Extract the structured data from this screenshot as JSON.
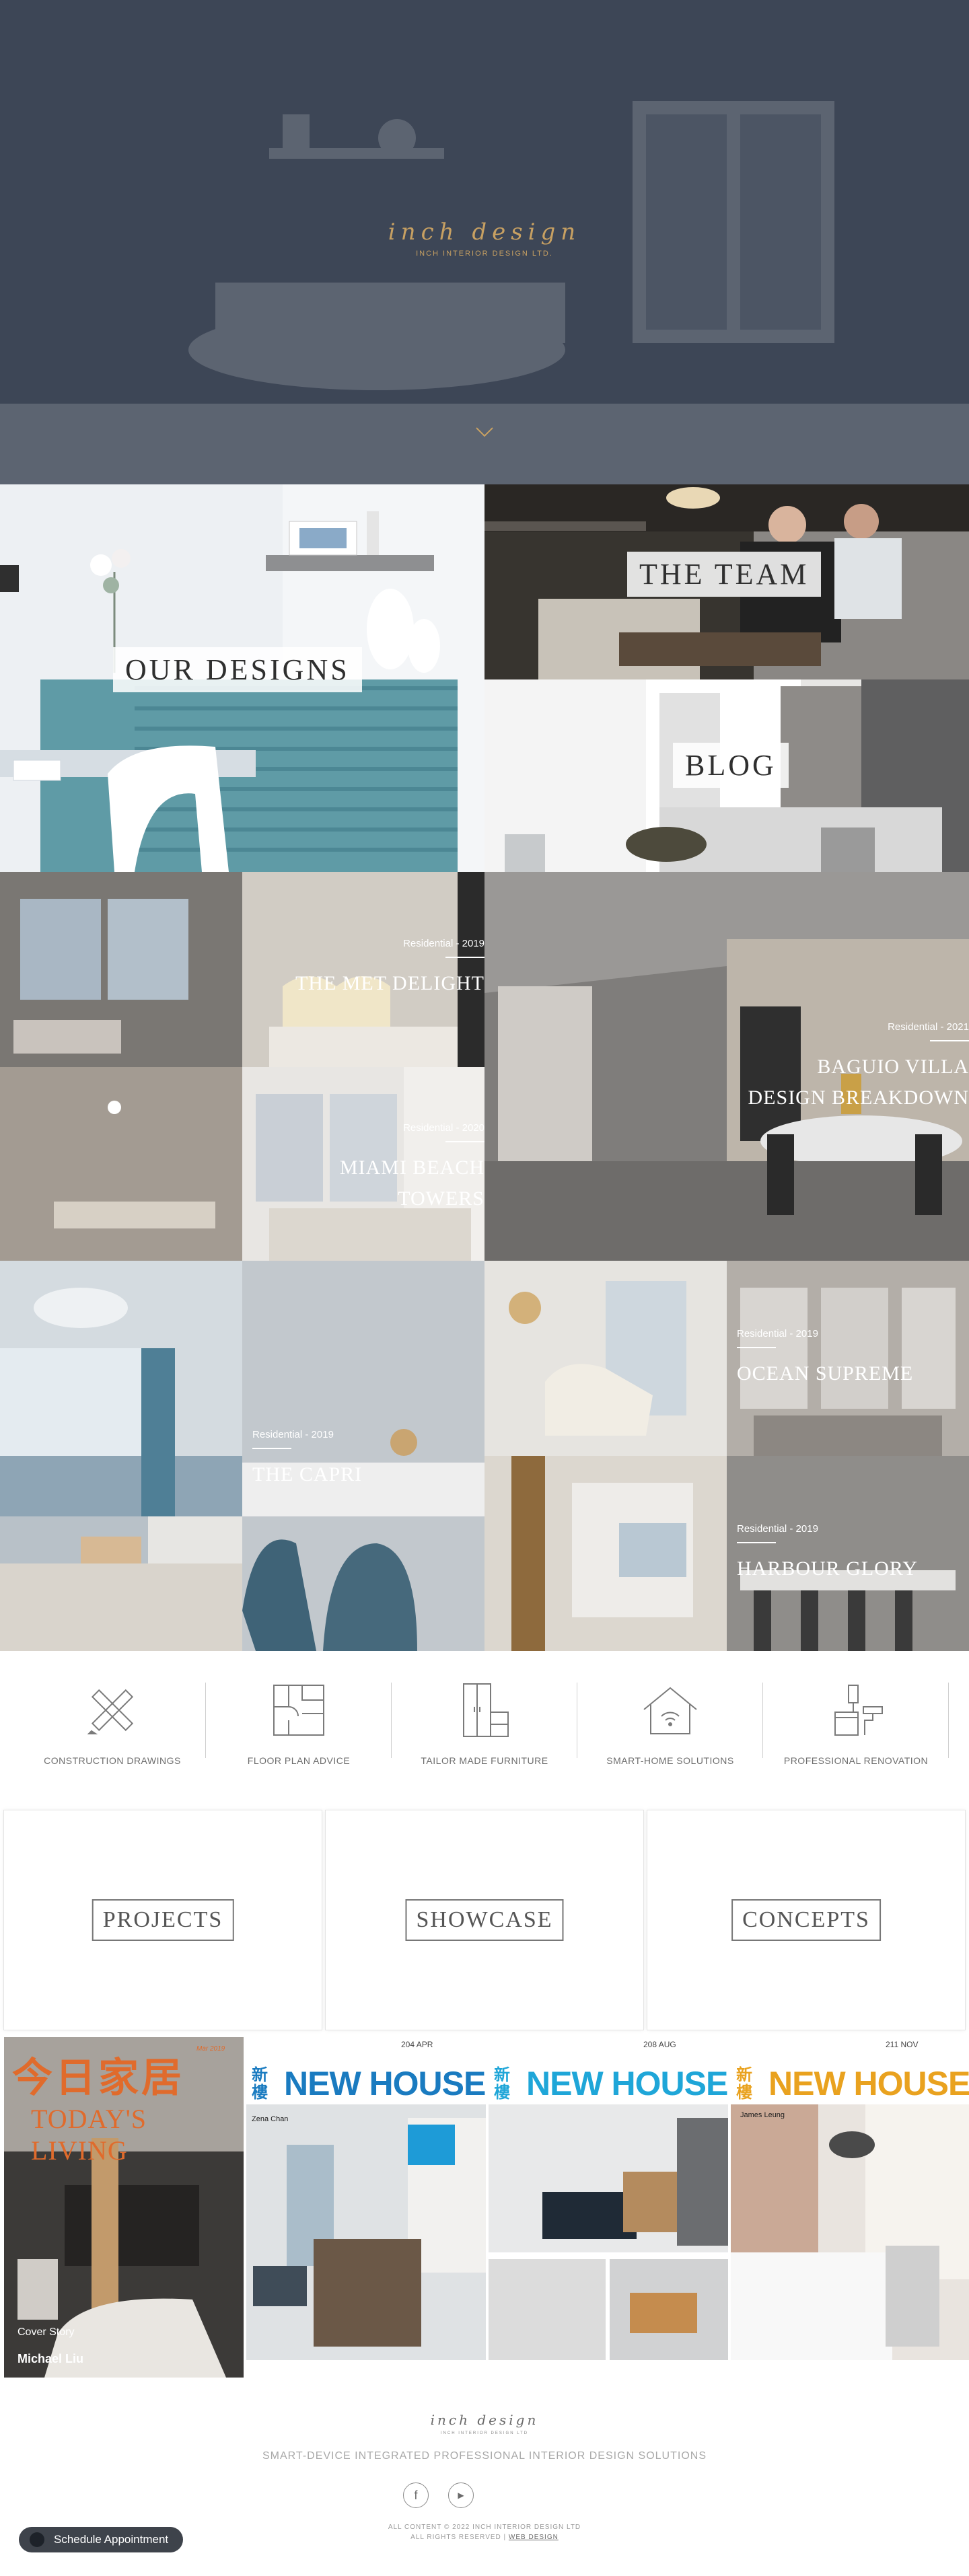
{
  "hero": {
    "logo_script": "inch design",
    "logo_sub": "INCH INTERIOR DESIGN LTD."
  },
  "tiles": {
    "our_designs": "OUR DESIGNS",
    "the_team": "THE TEAM",
    "blog": "BLOG"
  },
  "projects": [
    {
      "meta": "Residential - 2019",
      "title": "THE MET DELIGHT"
    },
    {
      "meta": "Residential - 2021",
      "title": "BAGUIO VILLA",
      "title2": "DESIGN BREAKDOWN"
    },
    {
      "meta": "Residential - 2020",
      "title": "MIAMI BEACH",
      "title2": "TOWERS"
    },
    {
      "meta": "Residential - 2019",
      "title": "THE CAPRI"
    },
    {
      "meta": "Residential - 2019",
      "title": "OCEAN SUPREME"
    },
    {
      "meta": "Residential - 2019",
      "title": "HARBOUR GLORY"
    }
  ],
  "services": [
    {
      "label": "CONSTRUCTION DRAWINGS",
      "icon": "ruler-pencil-icon"
    },
    {
      "label": "FLOOR PLAN ADVICE",
      "icon": "floor-plan-icon"
    },
    {
      "label": "TAILOR MADE FURNITURE",
      "icon": "wardrobe-icon"
    },
    {
      "label": "SMART-HOME SOLUTIONS",
      "icon": "smart-home-icon"
    },
    {
      "label": "PROFESSIONAL RENOVATION",
      "icon": "paint-roller-icon"
    }
  ],
  "categories": {
    "projects": "PROJECTS",
    "showcase": "SHOWCASE",
    "concepts": "CONCEPTS"
  },
  "magazines": [
    {
      "masthead": "今日家居",
      "sub": "TODAY'S LIVING",
      "date": "Mar 2019",
      "cover_story": "Cover Story",
      "name": "Michael Liu"
    },
    {
      "masthead_cn": "新樓",
      "masthead": "NEW HOUSE",
      "issue": "204",
      "month": "APR",
      "name": "Zena Chan"
    },
    {
      "masthead_cn": "新樓",
      "masthead": "NEW HOUSE",
      "issue": "208",
      "month": "AUG"
    },
    {
      "masthead_cn": "新樓",
      "masthead": "NEW HOUSE",
      "issue": "211",
      "month": "NOV",
      "name": "James Leung"
    }
  ],
  "footer": {
    "logo": "inch design",
    "logo_sub": "INCH INTERIOR DESIGN LTD",
    "tagline": "SMART-DEVICE INTEGRATED PROFESSIONAL INTERIOR DESIGN SOLUTIONS",
    "copyright": "ALL CONTENT © 2022 INCH INTERIOR DESIGN LTD",
    "rights": "ALL RIGHTS RESERVED |",
    "web_design": "WEB DESIGN",
    "schedule_button": "Schedule Appointment",
    "facebook_glyph": "f",
    "youtube_glyph": "▶"
  },
  "colors": {
    "hero_bg": "#3d4656",
    "gold": "#c7a062",
    "button_dark": "#3e434b"
  }
}
